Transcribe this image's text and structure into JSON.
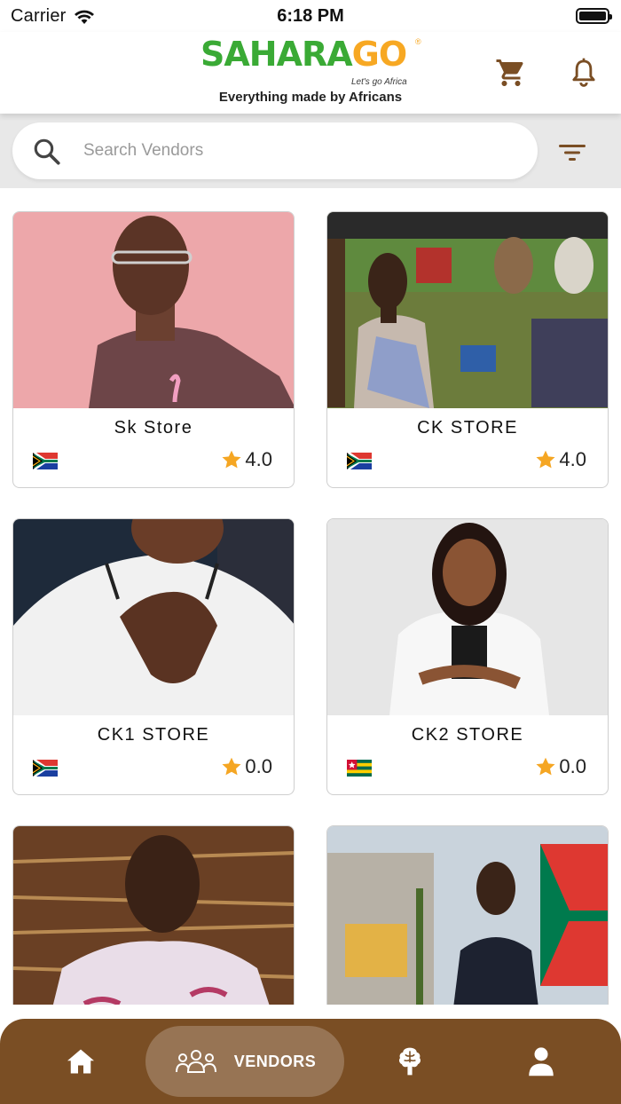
{
  "status_bar": {
    "carrier": "Carrier",
    "time": "6:18 PM"
  },
  "header": {
    "logo_part1": "SAHARA",
    "logo_part2": "GO",
    "logo_tagline": "Let's go Africa",
    "logo_reg": "®",
    "subtitle": "Everything made by Africans",
    "icons": [
      "cart-icon",
      "bell-icon"
    ]
  },
  "search": {
    "placeholder": "Search Vendors",
    "value": ""
  },
  "colors": {
    "brand_brown": "#7a4e24",
    "star": "#f5a623",
    "logo_green": "#3aaa35",
    "logo_orange": "#f7a823"
  },
  "vendors": [
    {
      "name": "Sk Store",
      "flag": "south-africa-flag",
      "rating": "4.0"
    },
    {
      "name": "CK STORE",
      "flag": "south-africa-flag",
      "rating": "4.0"
    },
    {
      "name": "CK1 STORE",
      "flag": "south-africa-flag",
      "rating": "0.0"
    },
    {
      "name": "CK2 STORE",
      "flag": "togo-flag",
      "rating": "0.0"
    },
    {
      "name": "",
      "flag": "",
      "rating": ""
    },
    {
      "name": "",
      "flag": "",
      "rating": ""
    }
  ],
  "bottom_nav": {
    "items": [
      "home-icon",
      "vendors-icon",
      "brain-icon",
      "profile-icon"
    ],
    "active_label": "VENDORS"
  }
}
